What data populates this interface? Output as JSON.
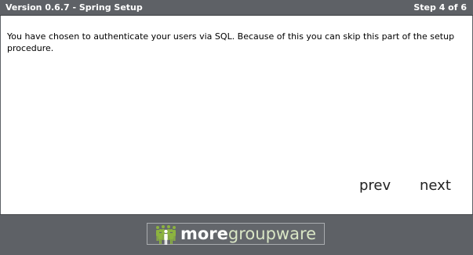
{
  "header": {
    "version_title": "Version 0.6.7 - Spring Setup",
    "step_label": "Step 4 of 6"
  },
  "main": {
    "message": "You have chosen to authenticate your users via SQL. Because of this you can skip this part of the setup procedure."
  },
  "navigation": {
    "prev_label": "prev",
    "next_label": "next"
  },
  "footer": {
    "logo_word_1": "more",
    "logo_word_2": "groupware",
    "logo_icon": "people-group-icon"
  },
  "colors": {
    "bar": "#5e6166",
    "logo_green": "#8cb33f",
    "text": "#000000"
  }
}
